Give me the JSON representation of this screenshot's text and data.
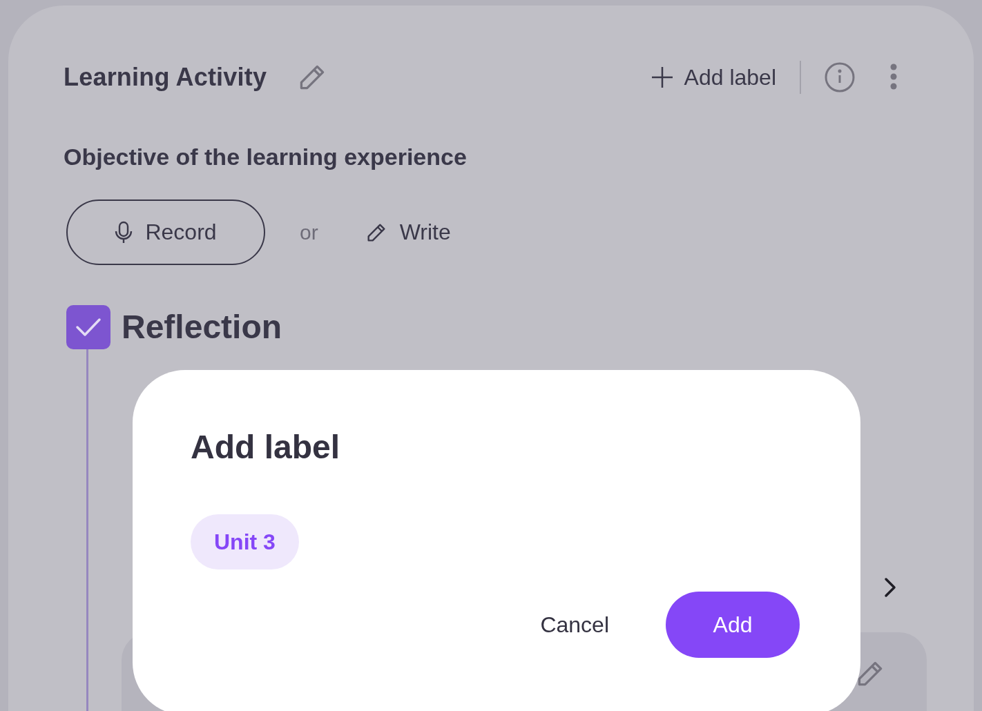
{
  "header": {
    "title": "Learning Activity",
    "add_label": "Add label"
  },
  "objective": {
    "heading": "Objective of the learning experience",
    "record": "Record",
    "or": "or",
    "write": "Write"
  },
  "reflection": {
    "title": "Reflection",
    "checked": true
  },
  "dialog": {
    "title": "Add label",
    "labels": [
      {
        "text": "Unit 3"
      }
    ],
    "cancel": "Cancel",
    "confirm": "Add"
  }
}
